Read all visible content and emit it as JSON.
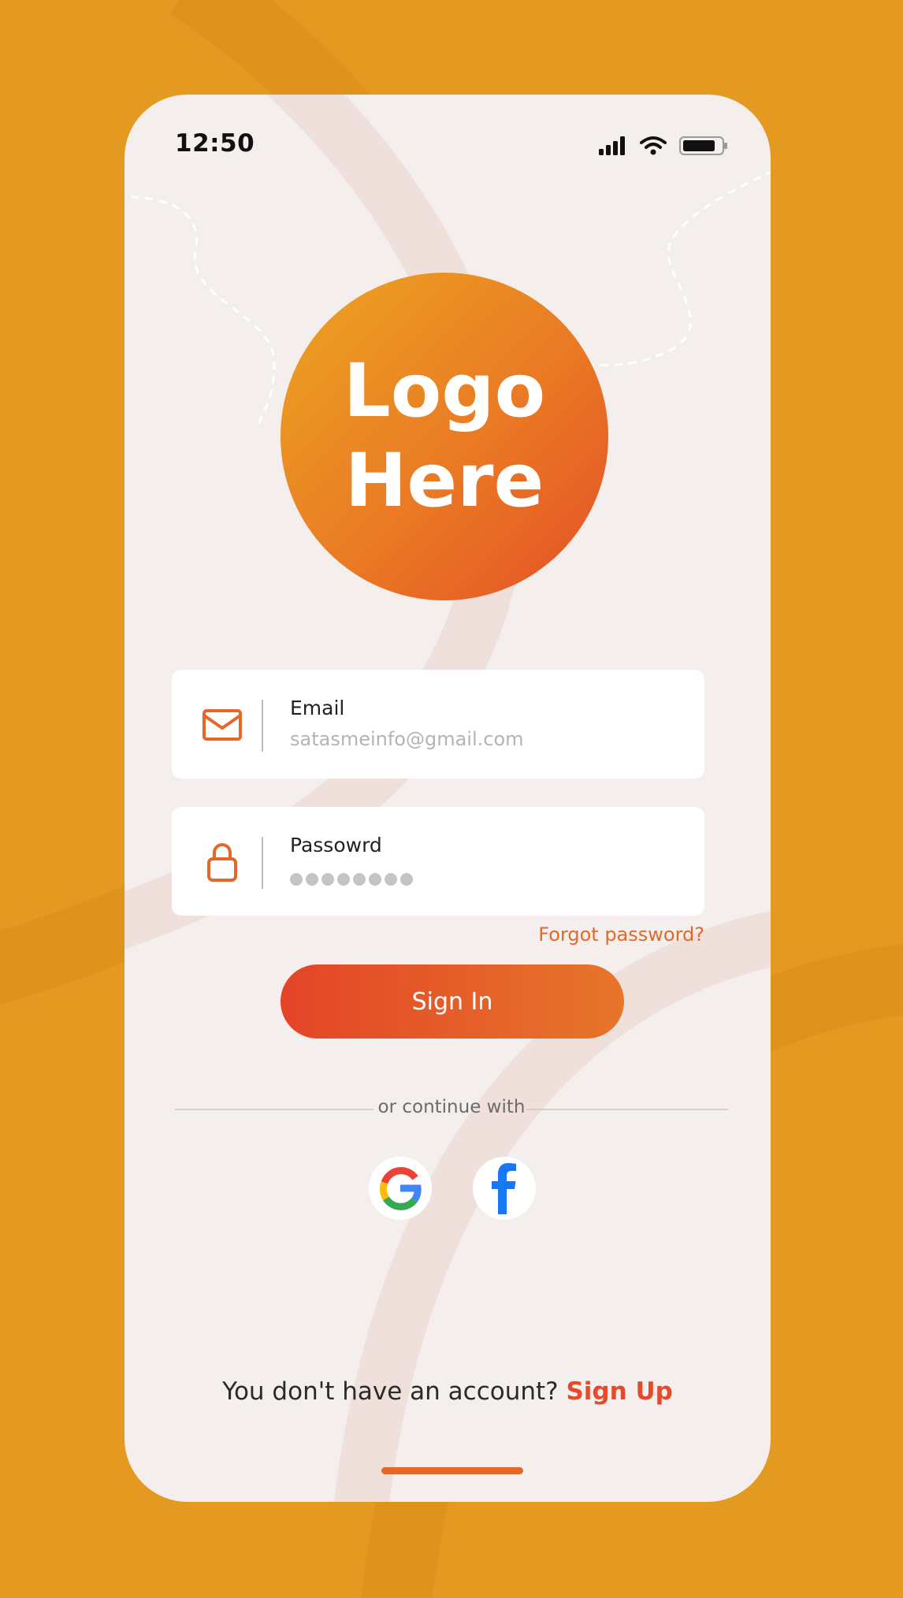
{
  "status_bar": {
    "time": "12:50"
  },
  "logo": {
    "line1": "Logo",
    "line2": "Here"
  },
  "email_field": {
    "label": "Email",
    "value": "satasmeinfo@gmail.com",
    "icon": "mail-icon"
  },
  "password_field": {
    "label": "Passowrd",
    "masked_length": 8,
    "icon": "lock-icon"
  },
  "forgot_password": "Forgot password?",
  "sign_in_button": "Sign In",
  "divider_text": "or continue with",
  "social": [
    {
      "name": "google",
      "icon": "google-icon"
    },
    {
      "name": "facebook",
      "icon": "facebook-icon"
    }
  ],
  "footer": {
    "prompt": "You don't have an account?",
    "link": "Sign Up"
  },
  "colors": {
    "background": "#e49a20",
    "accent": "#e5682a",
    "link_red": "#e64a2a",
    "screen": "#f4efed"
  }
}
